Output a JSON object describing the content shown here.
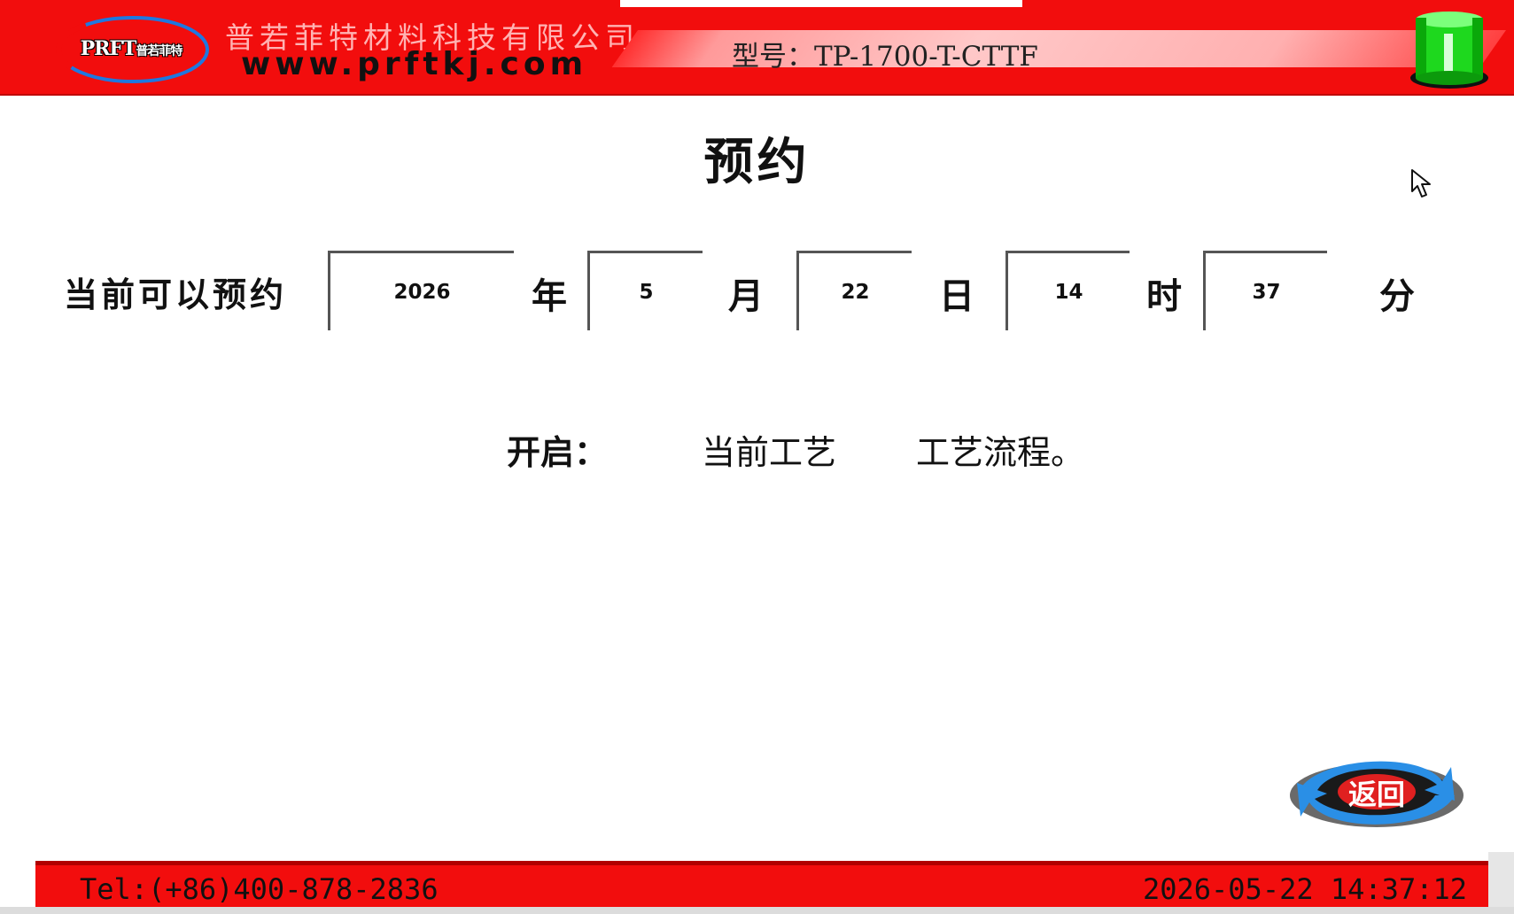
{
  "header": {
    "logo_text": "PRFT",
    "logo_text_cn": "普若菲特",
    "company_name": "普若菲特材料科技有限公司",
    "company_url": "www.prftkj.com",
    "model_label": "型号：TP-1700-T-CTTF",
    "status_light_color": "#22dd22"
  },
  "main": {
    "title": "预约",
    "schedule_label": "当前可以预约",
    "year_value": "2026",
    "year_unit": "年",
    "month_value": "5",
    "month_unit": "月",
    "day_value": "22",
    "day_unit": "日",
    "hour_value": "14",
    "hour_unit": "时",
    "minute_value": "37",
    "minute_unit": "分",
    "status_prefix": "开启：",
    "status_current": "当前工艺",
    "status_suffix": "工艺流程。"
  },
  "back_button": {
    "label": "返回"
  },
  "footer": {
    "tel": "Tel:(+86)400-878-2836",
    "datetime": "2026-05-22 14:37:12"
  },
  "colors": {
    "header_red": "#f20d0d",
    "footer_red": "#f20d0d",
    "accent_blue": "#2a8fe6"
  }
}
